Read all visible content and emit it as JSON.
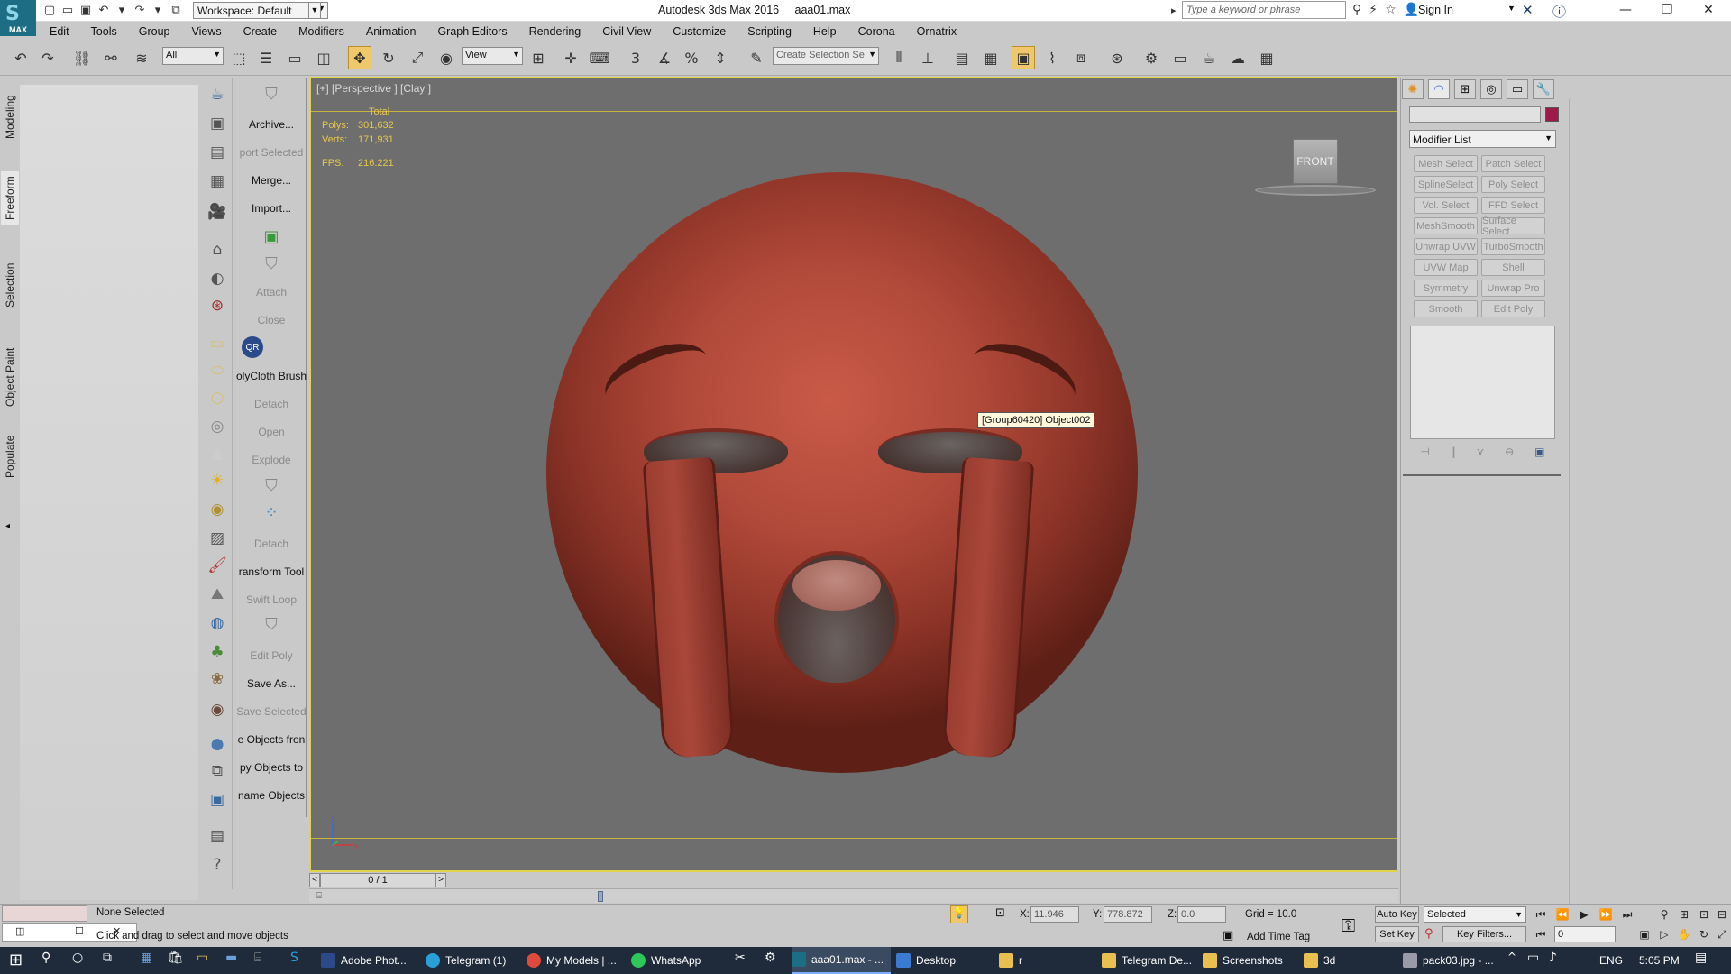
{
  "app": {
    "logo_text": "MAX",
    "title": "Autodesk 3ds Max 2016",
    "file": "aaa01.max",
    "workspace": "Workspace: Default",
    "search_placeholder": "Type a keyword or phrase",
    "signin": "Sign In"
  },
  "menu": [
    "Edit",
    "Tools",
    "Group",
    "Views",
    "Create",
    "Modifiers",
    "Animation",
    "Graph Editors",
    "Rendering",
    "Civil View",
    "Customize",
    "Scripting",
    "Help",
    "Corona",
    "Ornatrix"
  ],
  "toolbar": {
    "filter": "All",
    "ref_coord": "View",
    "selection_set": "Create Selection Se"
  },
  "ribbon_tabs": [
    "Modeling",
    "Freeform",
    "Selection",
    "Object Paint",
    "Populate"
  ],
  "command_list": [
    {
      "label": "Archive...",
      "disabled": false
    },
    {
      "label": "port Selected",
      "disabled": true
    },
    {
      "label": "Merge...",
      "disabled": false
    },
    {
      "label": "Import...",
      "disabled": false
    },
    {
      "label": "Attach",
      "disabled": true
    },
    {
      "label": "Close",
      "disabled": true
    },
    {
      "label": "olyCloth Brush",
      "disabled": false
    },
    {
      "label": "Detach",
      "disabled": true
    },
    {
      "label": "Open",
      "disabled": true
    },
    {
      "label": "Explode",
      "disabled": true
    },
    {
      "label": "Detach",
      "disabled": true
    },
    {
      "label": "ransform Tool",
      "disabled": false
    },
    {
      "label": "Swift Loop",
      "disabled": true
    },
    {
      "label": "Edit Poly",
      "disabled": true
    },
    {
      "label": "Save As...",
      "disabled": false
    },
    {
      "label": "Save Selected",
      "disabled": true
    },
    {
      "label": "e Objects fron",
      "disabled": false
    },
    {
      "label": "py Objects to",
      "disabled": false
    },
    {
      "label": "name Objects",
      "disabled": false
    }
  ],
  "viewport": {
    "label": "[+] [Perspective ] [Clay ]",
    "stats_header": "Total",
    "polys_label": "Polys:",
    "polys": "301,632",
    "verts_label": "Verts:",
    "verts": "171,931",
    "fps_label": "FPS:",
    "fps": "216.221",
    "tooltip": "[Group60420] Object002",
    "viewcube": "FRONT",
    "axis_z": "z",
    "axis_x": "x"
  },
  "timeline": {
    "frame": "0 / 1",
    "prev": "<",
    "next": ">"
  },
  "command_panel": {
    "modifier_list": "Modifier List",
    "color": "#a0174a",
    "modifiers": [
      "Mesh Select",
      "Patch Select",
      "SplineSelect",
      "Poly Select",
      "Vol. Select",
      "FFD Select",
      "MeshSmooth",
      "Surface Select",
      "Unwrap UVW",
      "TurboSmooth",
      "UVW Map",
      "Shell",
      "Symmetry",
      "Unwrap Pro",
      "Smooth",
      "Edit Poly"
    ]
  },
  "status": {
    "selection": "None Selected",
    "prompt": "Click and drag to select and move objects",
    "x_label": "X:",
    "x": "11.946",
    "y_label": "Y:",
    "y": "778.872",
    "z_label": "Z:",
    "z": "0.0",
    "grid": "Grid = 10.0",
    "add_time_tag": "Add Time Tag",
    "auto_key": "Auto Key",
    "set_key": "Set Key",
    "selected": "Selected",
    "key_filters": "Key Filters...",
    "frame_value": "0"
  },
  "taskbar": {
    "items": [
      {
        "label": "Adobe Phot...",
        "color": "#2a4a8a",
        "active": false
      },
      {
        "label": "Telegram (1)",
        "color": "#2aa0d8",
        "active": false
      },
      {
        "label": "My Models | ...",
        "color": "#e04a3a",
        "active": false
      },
      {
        "label": "WhatsApp",
        "color": "#2ec85a",
        "active": false
      },
      {
        "label": "aaa01.max - ...",
        "color": "#1d6d85",
        "active": true
      },
      {
        "label": "Desktop",
        "color": "#3a7ad0",
        "active": false
      },
      {
        "label": "r",
        "color": "#e8c050",
        "active": false
      },
      {
        "label": "Telegram De...",
        "color": "#e8c050",
        "active": false
      },
      {
        "label": "Screenshots",
        "color": "#e8c050",
        "active": false
      },
      {
        "label": "3d",
        "color": "#e8c050",
        "active": false
      },
      {
        "label": "pack03.jpg - ...",
        "color": "#9a9aa8",
        "active": false
      }
    ],
    "lang": "ENG",
    "time": "5:05 PM"
  }
}
